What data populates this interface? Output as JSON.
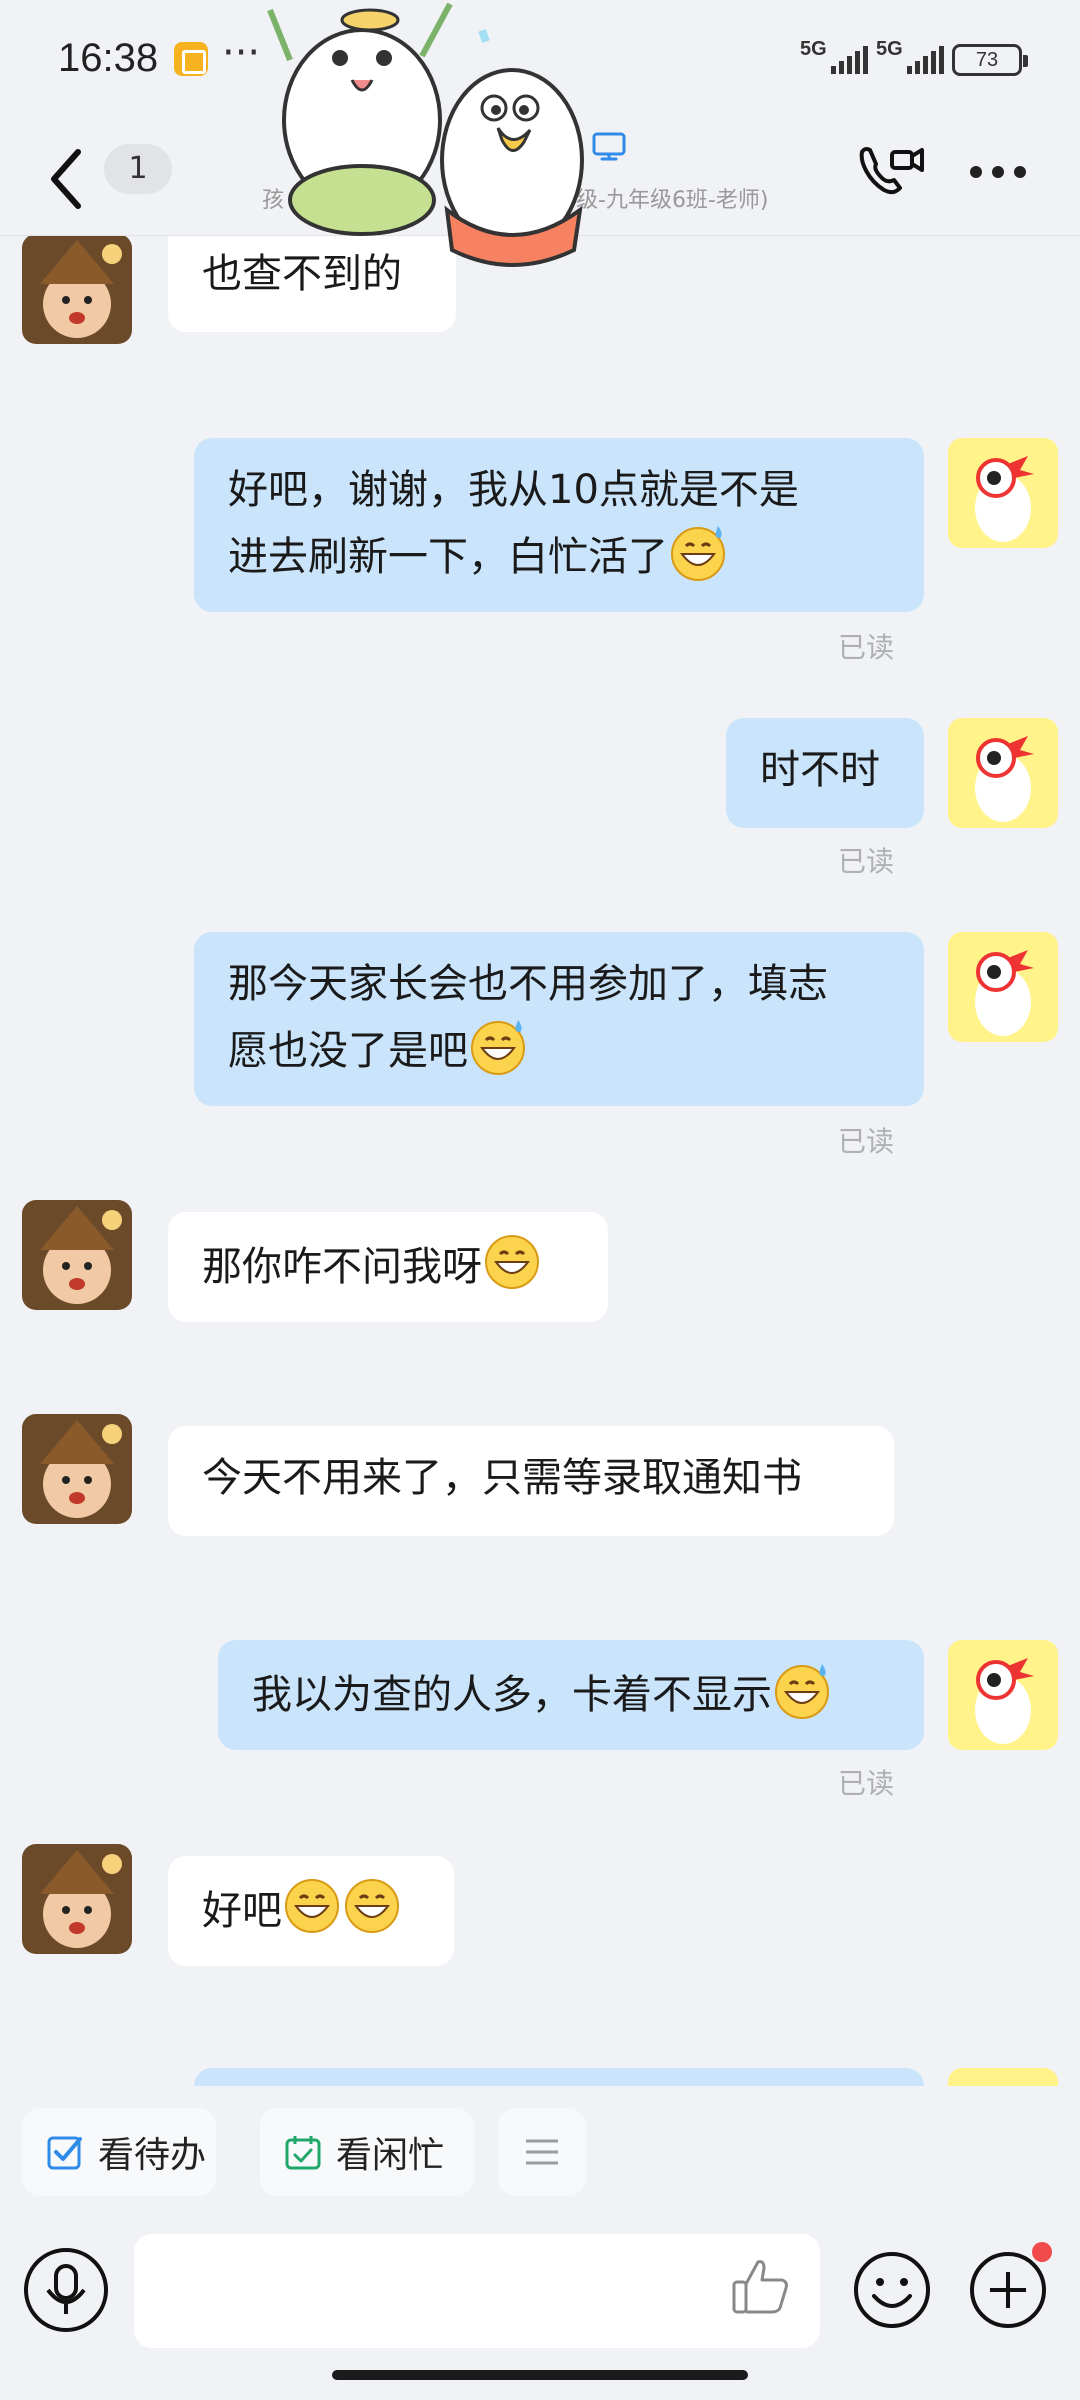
{
  "status_bar": {
    "time": "16:38",
    "dots": "···",
    "network_1": "5G",
    "network_2": "5G",
    "battery": "73"
  },
  "header": {
    "unread_count": "1",
    "title_left": "孩",
    "title_right": "级-九年级6班-老师)"
  },
  "messages": [
    {
      "side": "in",
      "text": "也查不到的"
    },
    {
      "side": "out",
      "line1": "好吧，谢谢，我从10点就是不是",
      "line2": "进去刷新一下，白忙活了",
      "read": "已读"
    },
    {
      "side": "out",
      "text": "时不时",
      "read": "已读"
    },
    {
      "side": "out",
      "line1": "那今天家长会也不用参加了，填志",
      "line2": "愿也没了是吧",
      "read": "已读"
    },
    {
      "side": "in",
      "text": "那你咋不问我呀"
    },
    {
      "side": "in",
      "text": "今天不用来了，只需等录取通知书"
    },
    {
      "side": "out",
      "text": "我以为查的人多，卡着不显示",
      "read": "已读"
    },
    {
      "side": "in",
      "text": "好吧"
    }
  ],
  "quick_actions": {
    "todo_label": "看待办",
    "schedule_label": "看闲忙"
  },
  "colors": {
    "background": "#f1f2f5",
    "bubble_out": "#c9e4fb",
    "bubble_in": "#ffffff",
    "accent_blue": "#2f8ae8",
    "accent_green": "#20a86b",
    "notification_red": "#f04a4a"
  },
  "icons": [
    "back-arrow-icon",
    "computer-icon",
    "video-call-icon",
    "more-icon",
    "checkbox-icon",
    "calendar-icon",
    "menu-icon",
    "mic-icon",
    "thumbs-up-icon",
    "smiley-icon",
    "plus-icon",
    "grin-sweat-emoji",
    "grin-emoji"
  ]
}
